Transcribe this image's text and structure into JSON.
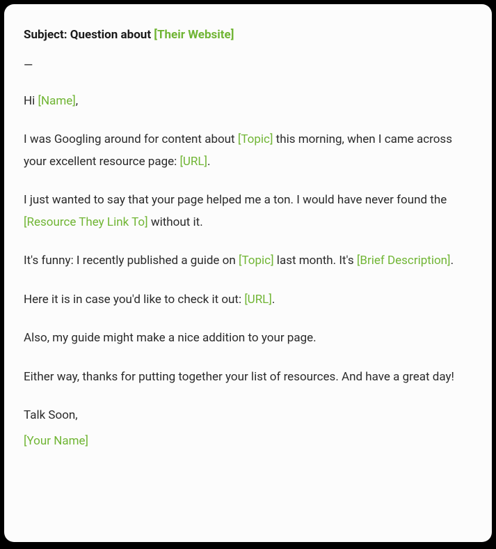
{
  "subject": {
    "label": "Subject: Question about ",
    "placeholder": "[Their Website]"
  },
  "divider": "—",
  "greeting": {
    "pre": "Hi ",
    "placeholder": "[Name]",
    "post": ","
  },
  "p1": {
    "t1": "I was Googling around for content about ",
    "ph1": "[Topic]",
    "t2": " this morning, when I came across your excellent resource page: ",
    "ph2": "[URL]",
    "t3": "."
  },
  "p2": {
    "t1": "I just wanted to say that your page helped me a ton. I would have never found the ",
    "ph1": "[Resource They Link To]",
    "t2": " without it."
  },
  "p3": {
    "t1": "It's funny: I recently published a guide on ",
    "ph1": "[Topic]",
    "t2": " last month. It's ",
    "ph2": "[Brief Description]",
    "t3": "."
  },
  "p4": {
    "t1": "Here it is in case you'd like to check it out: ",
    "ph1": "[URL]",
    "t2": "."
  },
  "p5": "Also, my guide might make a nice addition to your page.",
  "p6": "Either way, thanks for putting together your list of resources. And have a great day!",
  "signoff": "Talk Soon,",
  "signature": "[Your Name]"
}
